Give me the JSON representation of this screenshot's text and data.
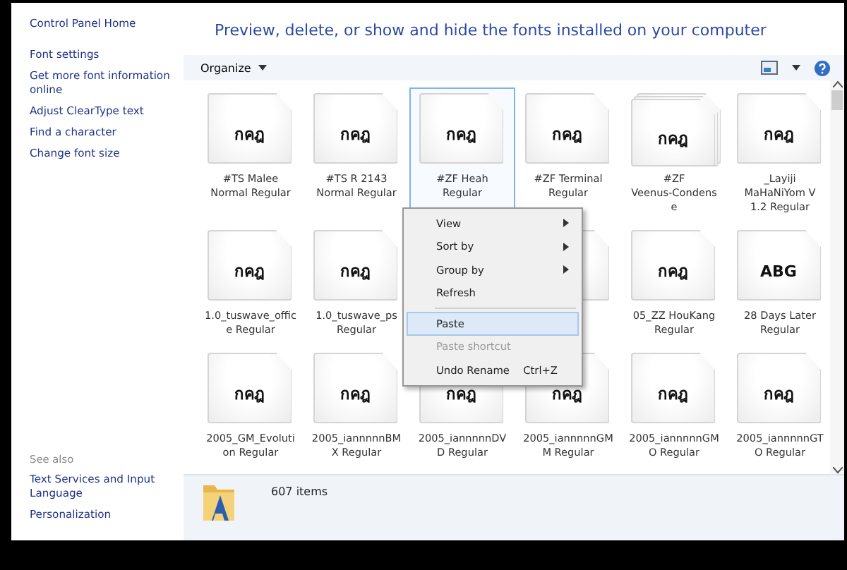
{
  "sidebar": {
    "home": "Control Panel Home",
    "links": [
      "Font settings",
      "Get more font information online",
      "Adjust ClearType text",
      "Find a character",
      "Change font size"
    ],
    "see_also_heading": "See also",
    "see_also": [
      "Text Services and Input Language",
      "Personalization"
    ]
  },
  "header": {
    "title": "Preview, delete, or show and hide the fonts installed on your computer"
  },
  "toolbar": {
    "organize": "Organize"
  },
  "fonts": [
    {
      "kind": "single",
      "sample": "กคฎ",
      "label": "#TS  Malee\nNormal Regular",
      "selected": false
    },
    {
      "kind": "single",
      "sample": "กคฎ",
      "label": "#TS  R 2143\nNormal Regular",
      "selected": false
    },
    {
      "kind": "single",
      "sample": "กคฎ",
      "label": "#ZF Heah\nRegular",
      "selected": true
    },
    {
      "kind": "single",
      "sample": "กคฎ",
      "label": "#ZF Terminal\nRegular",
      "selected": false
    },
    {
      "kind": "stack",
      "sample": "กคฎ",
      "label": "#ZF\nVeenus-Condens\ne",
      "selected": false
    },
    {
      "kind": "single",
      "sample": "กคฎ",
      "label": "_Layiji\nMaHaNiYom V\n1.2 Regular",
      "selected": false
    },
    {
      "kind": "single",
      "sample": "กคฎ",
      "label": "1.0_tuswave_offic\ne Regular",
      "selected": false
    },
    {
      "kind": "single",
      "sample": "กคฎ",
      "label": "1.0_tuswave_ps\nRegular",
      "selected": false
    },
    {
      "kind": "covered"
    },
    {
      "kind": "covered"
    },
    {
      "kind": "single",
      "sample": "กคฎ",
      "label": "05_ZZ HouKang\nRegular",
      "selected": false
    },
    {
      "kind": "single",
      "sample": "ABG",
      "label": "28 Days Later\nRegular",
      "selected": false
    },
    {
      "kind": "single",
      "sample": "กคฎ",
      "label": "2005_GM_Evoluti\non Regular",
      "selected": false
    },
    {
      "kind": "single",
      "sample": "กคฎ",
      "label": "2005_iannnnnBM\nX Regular",
      "selected": false
    },
    {
      "kind": "single",
      "sample": "กคฎ",
      "label": "2005_iannnnnDV\nD Regular",
      "selected": false
    },
    {
      "kind": "single",
      "sample": "กคฎ",
      "label": "2005_iannnnnGM\nM Regular",
      "selected": false
    },
    {
      "kind": "single",
      "sample": "กคฎ",
      "label": "2005_iannnnnGM\nO Regular",
      "selected": false
    },
    {
      "kind": "single",
      "sample": "กคฎ",
      "label": "2005_iannnnnGT\nO Regular",
      "selected": false
    }
  ],
  "context_menu": [
    {
      "kind": "submenu",
      "label": "View",
      "selected": false,
      "disabled": false
    },
    {
      "kind": "submenu",
      "label": "Sort by",
      "selected": false,
      "disabled": false
    },
    {
      "kind": "submenu",
      "label": "Group by",
      "selected": false,
      "disabled": false
    },
    {
      "kind": "item",
      "label": "Refresh",
      "selected": false,
      "disabled": false
    },
    {
      "kind": "separator"
    },
    {
      "kind": "item",
      "label": "Paste",
      "selected": true,
      "disabled": false
    },
    {
      "kind": "item",
      "label": "Paste shortcut",
      "selected": false,
      "disabled": true
    },
    {
      "kind": "item",
      "label": "Undo Rename",
      "shortcut": "Ctrl+Z",
      "selected": false,
      "disabled": false
    }
  ],
  "status_bar": {
    "count": "607 items"
  }
}
